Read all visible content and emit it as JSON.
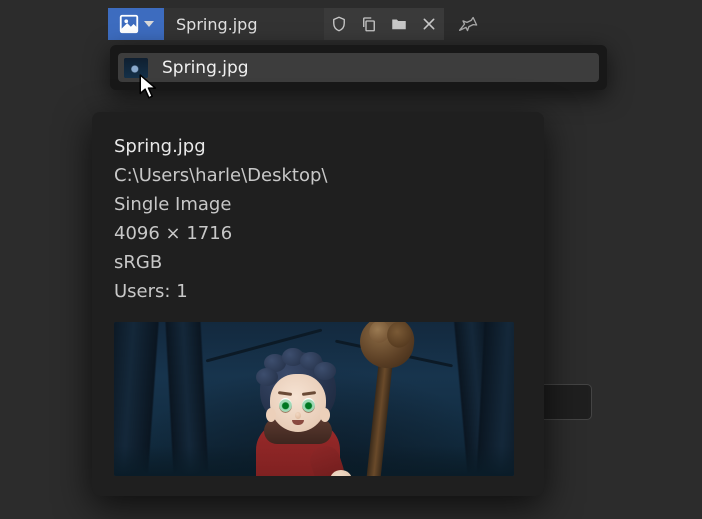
{
  "header": {
    "filename": "Spring.jpg"
  },
  "dropdown": {
    "items": [
      {
        "label": "Spring.jpg"
      }
    ]
  },
  "tooltip": {
    "filename": "Spring.jpg",
    "path": "C:\\Users\\harle\\Desktop\\",
    "type": "Single Image",
    "dimensions": "4096 × 1716",
    "colorspace": "sRGB",
    "users": "Users: 1"
  },
  "icons": {
    "image_selector": "image-icon",
    "shield": "shield-icon",
    "duplicate": "duplicate-icon",
    "folder": "folder-icon",
    "close": "close-icon",
    "pin": "pin-icon"
  }
}
